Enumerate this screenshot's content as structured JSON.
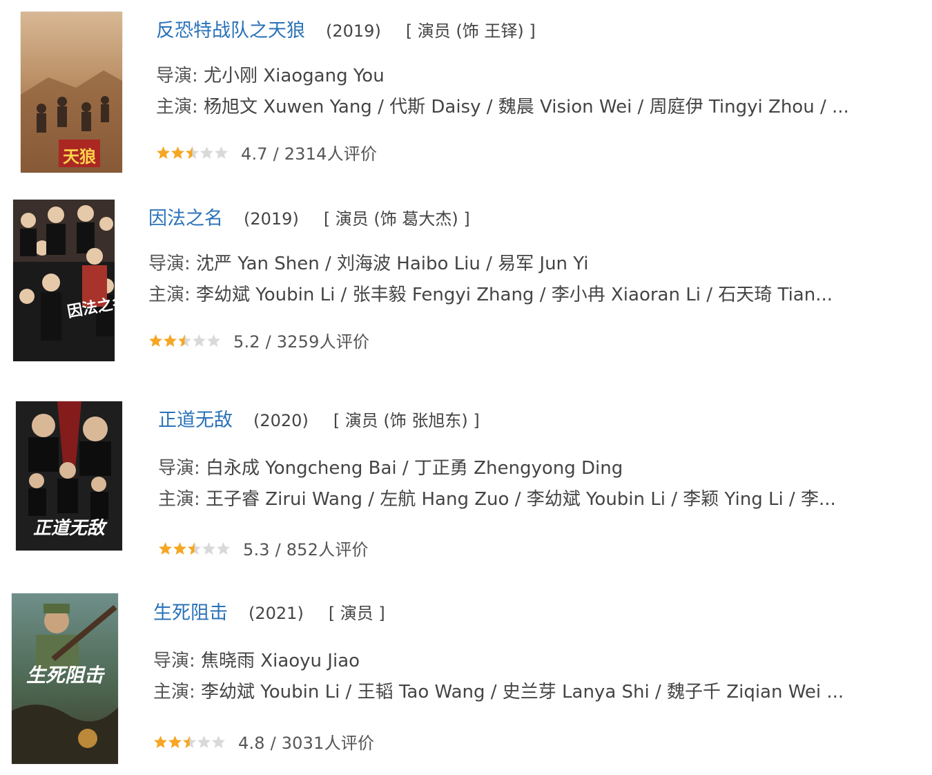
{
  "entries": [
    {
      "title": "反恐特战队之天狼",
      "year": "(2019)",
      "role": "[ 演员 (饰 王铎) ]",
      "director_label": "导演:",
      "director": "尤小刚 Xiaogang You",
      "cast_label": "主演:",
      "cast": "杨旭文 Xuwen Yang / 代斯 Daisy / 魏晨 Vision Wei / 周庭伊 Tingyi Zhou / ...",
      "rating_value": 4.7,
      "rating_text": "4.7 / 2314人评价",
      "poster_text": "天狼"
    },
    {
      "title": "因法之名",
      "year": "(2019)",
      "role": "[ 演员 (饰 葛大杰) ]",
      "director_label": "导演:",
      "director": "沈严 Yan Shen / 刘海波 Haibo Liu / 易军 Jun Yi",
      "cast_label": "主演:",
      "cast": "李幼斌 Youbin Li / 张丰毅 Fengyi Zhang / 李小冉 Xiaoran Li / 石天琦 Tian...",
      "rating_value": 5.2,
      "rating_text": "5.2 / 3259人评价",
      "poster_text": "因法之名"
    },
    {
      "title": "正道无敌",
      "year": "(2020)",
      "role": "[ 演员 (饰 张旭东) ]",
      "director_label": "导演:",
      "director": "白永成 Yongcheng Bai / 丁正勇 Zhengyong Ding",
      "cast_label": "主演:",
      "cast": "王子睿 Zirui Wang / 左航 Hang Zuo / 李幼斌 Youbin Li / 李颖 Ying Li / 李...",
      "rating_value": 5.3,
      "rating_text": "5.3 / 852人评价",
      "poster_text": "正道无敌"
    },
    {
      "title": "生死阻击",
      "year": "(2021)",
      "role": "[ 演员 ]",
      "director_label": "导演:",
      "director": "焦晓雨 Xiaoyu Jiao",
      "cast_label": "主演:",
      "cast": "李幼斌 Youbin Li / 王韬 Tao Wang / 史兰芽 Lanya Shi / 魏子千 Ziqian Wei ...",
      "rating_value": 4.8,
      "rating_text": "4.8 / 3031人评价",
      "poster_text": "生死阻击"
    }
  ],
  "colors": {
    "title_link": "#2a72b8",
    "star_on": "#f5a623",
    "star_off": "#d9d9d9"
  }
}
